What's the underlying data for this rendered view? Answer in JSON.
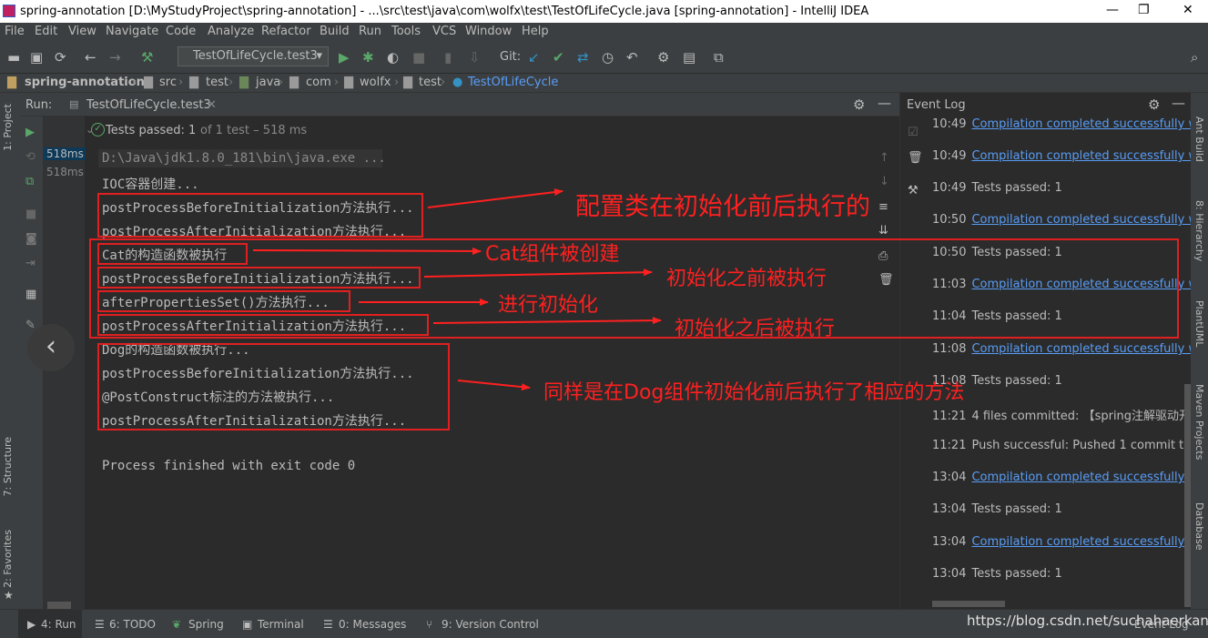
{
  "window": {
    "title": "spring-annotation [D:\\MyStudyProject\\spring-annotation] - ...\\src\\test\\java\\com\\wolfx\\test\\TestOfLifeCycle.java [spring-annotation] - IntelliJ IDEA",
    "min": "—",
    "max": "❐",
    "close": "✕"
  },
  "menu": [
    "File",
    "Edit",
    "View",
    "Navigate",
    "Code",
    "Analyze",
    "Refactor",
    "Build",
    "Run",
    "Tools",
    "VCS",
    "Window",
    "Help"
  ],
  "toolbar": {
    "run_config": "TestOfLifeCycle.test3",
    "git_label": "Git:"
  },
  "breadcrumb": [
    "spring-annotation",
    "src",
    "test",
    "java",
    "com",
    "wolfx",
    "test",
    "TestOfLifeCycle"
  ],
  "run_panel": {
    "label": "Run:",
    "tab": "TestOfLifeCycle.test3",
    "status_prefix": "Tests passed:",
    "status_count": "1",
    "status_suffix": "of 1 test – 518 ms",
    "tree_time_1": "518ms",
    "tree_time_2": "518ms"
  },
  "console": [
    "D:\\Java\\jdk1.8.0_181\\bin\\java.exe ...",
    "IOC容器创建...",
    "postProcessBeforeInitialization方法执行...",
    "postProcessAfterInitialization方法执行...",
    "Cat的构造函数被执行",
    "postProcessBeforeInitialization方法执行...",
    "afterPropertiesSet()方法执行...",
    "postProcessAfterInitialization方法执行...",
    "Dog的构造函数被执行...",
    "postProcessBeforeInitialization方法执行...",
    "@PostConstruct标注的方法被执行...",
    "postProcessAfterInitialization方法执行...",
    "",
    "Process finished with exit code 0"
  ],
  "annotations": {
    "config": "配置类在初始化前后执行的",
    "cat_created": "Cat组件被创建",
    "before_init": "初始化之前被执行",
    "do_init": "进行初始化",
    "after_init": "初始化之后被执行",
    "dog": "同样是在Dog组件初始化前后执行了相应的方法"
  },
  "event_log": {
    "title": "Event Log",
    "entries": [
      {
        "time": "10:49",
        "text": "Compilation completed successfully with",
        "link": true
      },
      {
        "time": "10:49",
        "text": "Compilation completed successfully with",
        "link": true
      },
      {
        "time": "10:49",
        "text": "Tests passed: 1",
        "link": false
      },
      {
        "time": "10:50",
        "text": "Compilation completed successfully with",
        "link": true
      },
      {
        "time": "10:50",
        "text": "Tests passed: 1",
        "link": false
      },
      {
        "time": "11:03",
        "text": "Compilation completed successfully with",
        "link": true
      },
      {
        "time": "11:04",
        "text": "Tests passed: 1",
        "link": false
      },
      {
        "time": "11:08",
        "text": "Compilation completed successfully with",
        "link": true
      },
      {
        "time": "11:08",
        "text": "Tests passed: 1",
        "link": false
      },
      {
        "time": "11:21",
        "text": "4 files committed: 【spring注解驱动开发】",
        "link": false
      },
      {
        "time": "11:21",
        "text": "Push successful: Pushed 1 commit to spr",
        "link": false
      },
      {
        "time": "13:04",
        "text": "Compilation completed successfully with",
        "link": true
      },
      {
        "time": "13:04",
        "text": "Tests passed: 1",
        "link": false
      },
      {
        "time": "13:04",
        "text": "Compilation completed successfully with",
        "link": true
      },
      {
        "time": "13:04",
        "text": "Tests passed: 1",
        "link": false
      }
    ]
  },
  "left_tabs": [
    "1: Project",
    "7: Structure",
    "2: Favorites"
  ],
  "right_tabs": [
    "Ant Build",
    "8: Hierarchy",
    "PlantUML",
    "Maven Projects",
    "Database"
  ],
  "bottom_tabs": [
    "4: Run",
    "6: TODO",
    "Spring",
    "Terminal",
    "0: Messages",
    "9: Version Control"
  ],
  "bottom_right": "Event Log",
  "watermark": "https://blog.csdn.net/suchahaerkang",
  "colors": {
    "accent_red": "#ff2020",
    "link": "#589df6",
    "ide_bg": "#2b2b2b",
    "pass_green": "#59a869"
  }
}
